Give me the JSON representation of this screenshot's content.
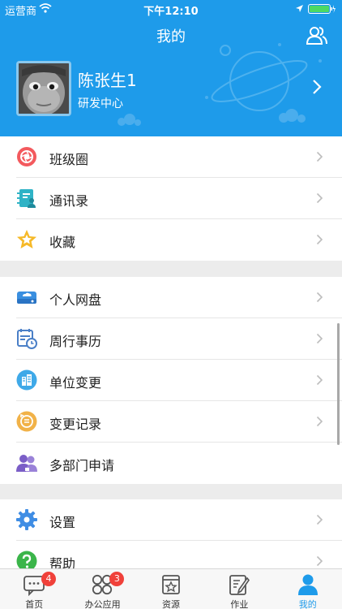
{
  "status_bar": {
    "carrier": "运营商",
    "time": "下午12:10"
  },
  "navbar": {
    "title": "我的"
  },
  "profile": {
    "name": "陈张生1",
    "department": "研发中心"
  },
  "menu_group_1": [
    {
      "label": "班级圈",
      "icon": "camera-aperture-icon"
    },
    {
      "label": "通讯录",
      "icon": "address-book-icon"
    },
    {
      "label": "收藏",
      "icon": "star-icon"
    }
  ],
  "menu_group_2": [
    {
      "label": "个人网盘",
      "icon": "cloud-drive-icon"
    },
    {
      "label": "周行事历",
      "icon": "calendar-clock-icon"
    },
    {
      "label": "单位变更",
      "icon": "building-icon"
    },
    {
      "label": "变更记录",
      "icon": "record-icon"
    },
    {
      "label": "多部门申请",
      "icon": "group-icon"
    }
  ],
  "menu_group_3": [
    {
      "label": "设置",
      "icon": "gear-icon"
    },
    {
      "label": "帮助",
      "icon": "help-icon"
    }
  ],
  "tabbar": {
    "tabs": [
      {
        "label": "首页",
        "badge": "4"
      },
      {
        "label": "办公应用",
        "badge": "3"
      },
      {
        "label": "资源"
      },
      {
        "label": "作业"
      },
      {
        "label": "我的"
      }
    ],
    "active_tab": "我的"
  },
  "colors": {
    "accent": "#1e9bea",
    "badge": "#f0413a",
    "background": "#ececec"
  }
}
